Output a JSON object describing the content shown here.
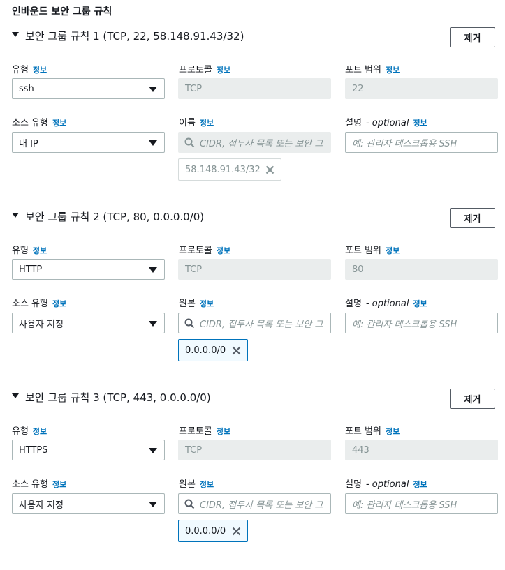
{
  "section_title": "인바운드 보안 그룹 규칙",
  "info_label": "정보",
  "remove_label": "제거",
  "labels": {
    "type": "유형",
    "protocol": "프로토콜",
    "port_range": "포트 범위",
    "source_type": "소스 유형",
    "description": "설명",
    "description_optional": "- optional"
  },
  "source_search_placeholder": "CIDR, 접두사 목록 또는 보안 그",
  "description_placeholder": "예: 관리자 데스크톱용 SSH",
  "rules": [
    {
      "title": "보안 그룹 규칙 1 (TCP, 22, 58.148.91.43/32)",
      "type": "ssh",
      "protocol": "TCP",
      "port": "22",
      "source_type": "내 IP",
      "source_label": "이름",
      "source_token": "58.148.91.43/32"
    },
    {
      "title": "보안 그룹 규칙 2 (TCP, 80, 0.0.0.0/0)",
      "type": "HTTP",
      "protocol": "TCP",
      "port": "80",
      "source_type": "사용자 지정",
      "source_label": "원본",
      "source_token": "0.0.0.0/0"
    },
    {
      "title": "보안 그룹 규칙 3 (TCP, 443, 0.0.0.0/0)",
      "type": "HTTPS",
      "protocol": "TCP",
      "port": "443",
      "source_type": "사용자 지정",
      "source_label": "원본",
      "source_token": "0.0.0.0/0"
    }
  ]
}
